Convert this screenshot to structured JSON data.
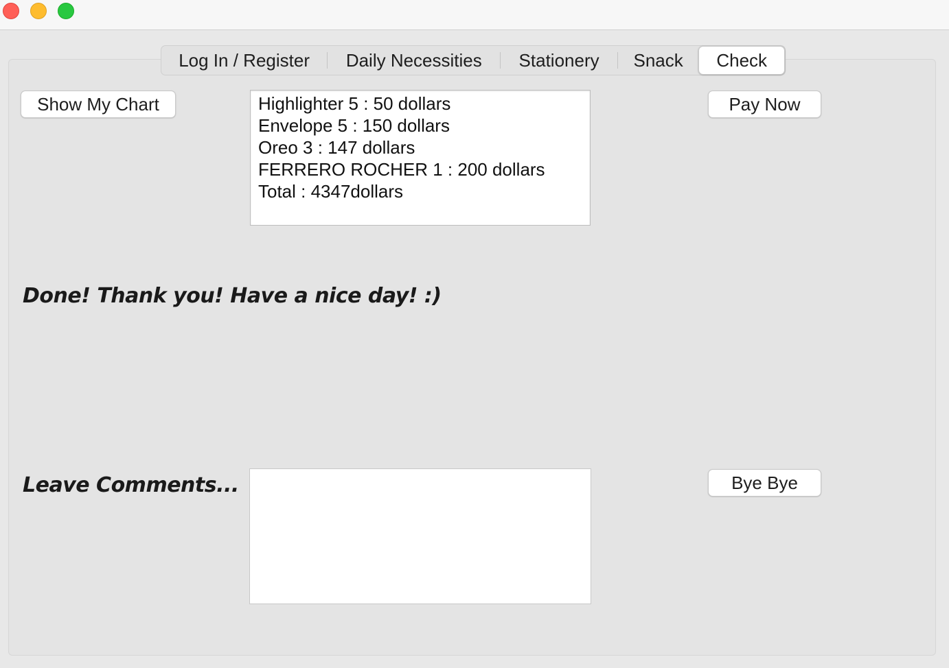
{
  "window": {
    "controls": [
      "close",
      "minimize",
      "maximize"
    ]
  },
  "tabs": [
    {
      "label": "Log In / Register",
      "active": false
    },
    {
      "label": "Daily Necessities",
      "active": false
    },
    {
      "label": "Stationery",
      "active": false
    },
    {
      "label": "Snack",
      "active": false
    },
    {
      "label": "Check",
      "active": true
    }
  ],
  "check": {
    "show_chart_label": "Show My Chart",
    "pay_now_label": "Pay Now",
    "receipt_lines": [
      "Highlighter 5 : 50 dollars",
      "Envelope 5 : 150 dollars",
      "Oreo 3 : 147 dollars",
      "FERRERO ROCHER 1 : 200 dollars",
      "Total : 4347dollars"
    ],
    "message": "Done! Thank you! Have a nice day! :)",
    "comments_label": "Leave Comments...",
    "comments_value": "",
    "bye_label": "Bye Bye"
  }
}
